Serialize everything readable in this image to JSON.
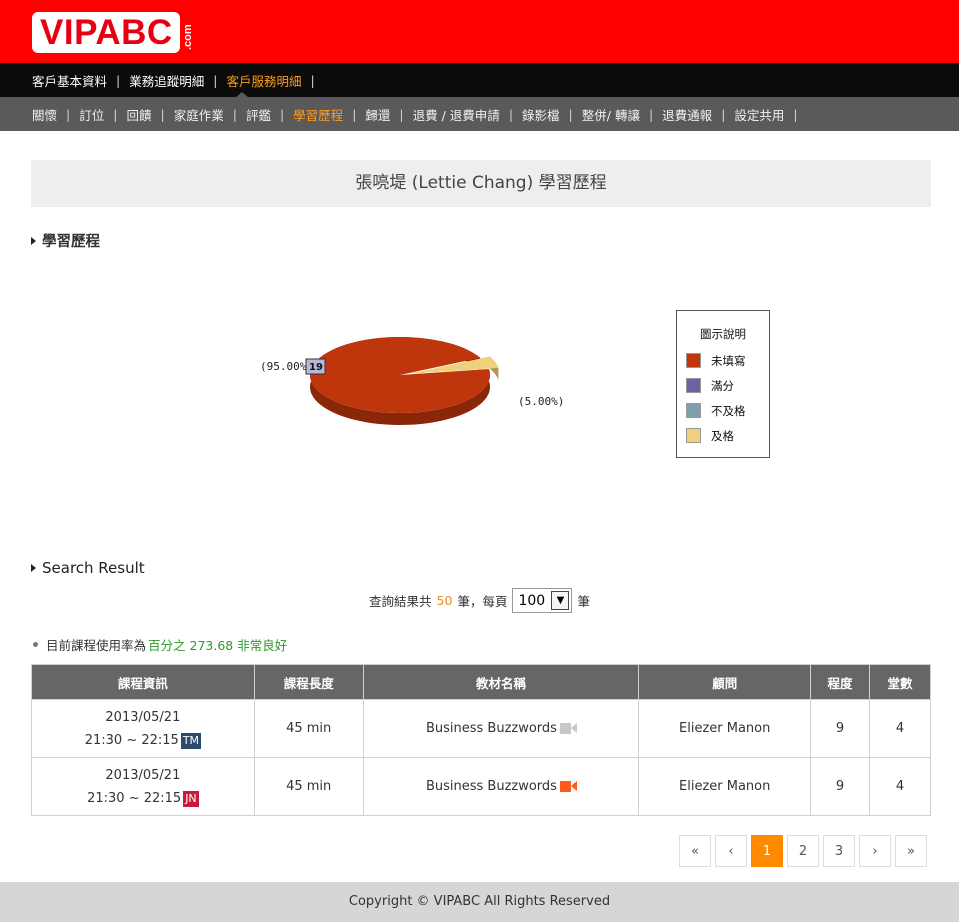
{
  "brand": {
    "logo_text": "VIPABC",
    "logo_suffix": ".com",
    "logo_color": "#e60012",
    "header_bg": "#ff0000"
  },
  "nav_primary": [
    {
      "label": "客戶基本資料",
      "active": false
    },
    {
      "label": "業務追蹤明細",
      "active": false
    },
    {
      "label": "客戶服務明細",
      "active": true
    }
  ],
  "nav_secondary": [
    {
      "label": "關懷",
      "active": false
    },
    {
      "label": "訂位",
      "active": false
    },
    {
      "label": "回饋",
      "active": false
    },
    {
      "label": "家庭作業",
      "active": false
    },
    {
      "label": "評鑑",
      "active": false
    },
    {
      "label": "學習歷程",
      "active": true
    },
    {
      "label": "歸還",
      "active": false
    },
    {
      "label": "退費 / 退費申請",
      "active": false
    },
    {
      "label": "錄影檔",
      "active": false
    },
    {
      "label": "整併/ 轉讓",
      "active": false
    },
    {
      "label": "退費通報",
      "active": false
    },
    {
      "label": "設定共用",
      "active": false
    }
  ],
  "page_title": "張喨堤 (Lettie Chang) 學習歷程",
  "section_learning": "學習歷程",
  "chart_data": {
    "type": "pie",
    "slices": [
      {
        "label": "未填寫",
        "value": 95.0,
        "color": "#c0360c",
        "data_label": "(95.00%",
        "count_label": "19"
      },
      {
        "label": "滿分",
        "value": 0,
        "color": "#6a63a3"
      },
      {
        "label": "不及格",
        "value": 0,
        "color": "#7fa0a8"
      },
      {
        "label": "及格",
        "value": 5.0,
        "color": "#f0d07a",
        "data_label": "(5.00%)"
      }
    ],
    "legend_title": "圖示說明",
    "legend_placement": "right"
  },
  "section_search": "Search Result",
  "query": {
    "prefix": "查詢結果共",
    "total": "50",
    "mid": "筆，每頁",
    "per_page": "100",
    "suffix": "筆"
  },
  "usage": {
    "text": "目前課程使用率為",
    "value": "百分之 273.68 非常良好"
  },
  "table": {
    "headers": [
      "課程資訊",
      "課程長度",
      "教材名稱",
      "顧問",
      "程度",
      "堂數"
    ],
    "rows": [
      {
        "date": "2013/05/21",
        "time": "21:30 ~ 22:15",
        "tag": "TM",
        "tag_color": "#2d4a6b",
        "length": "45 min",
        "material": "Business Buzzwords",
        "video_color": "#c8c8c8",
        "consultant": "Eliezer Manon",
        "level": "9",
        "sessions": "4"
      },
      {
        "date": "2013/05/21",
        "time": "21:30 ~ 22:15",
        "tag": "JN",
        "tag_color": "#c8193c",
        "length": "45 min",
        "material": "Business Buzzwords",
        "video_color": "#ff5a1a",
        "consultant": "Eliezer Manon",
        "level": "9",
        "sessions": "4"
      }
    ]
  },
  "pagination": {
    "first": "«",
    "prev": "‹",
    "pages": [
      "1",
      "2",
      "3"
    ],
    "current": "1",
    "next": "›",
    "last": "»",
    "accent": "#ff8a00"
  },
  "footer": "Copyright © VIPABC All Rights Reserved"
}
